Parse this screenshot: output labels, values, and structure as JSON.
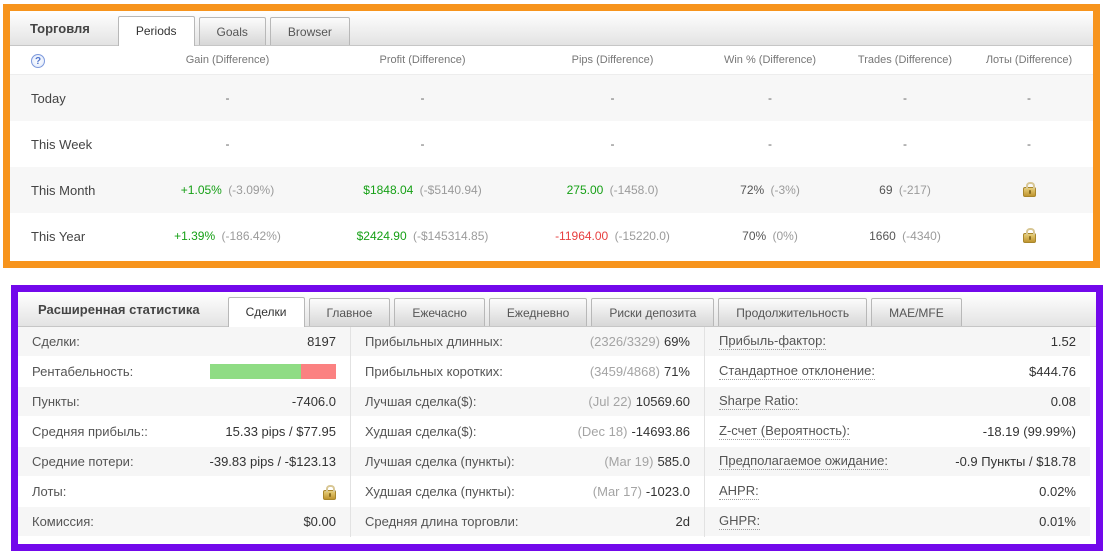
{
  "colors": {
    "annotation_top_border": "#F7941D",
    "annotation_bottom_border": "#7208EB",
    "positive_value": "#16A016",
    "negative_value": "#E74040",
    "muted_value": "#9B9B9B",
    "bar_green": "#8FDC84",
    "bar_red": "#FB8181"
  },
  "icons": {
    "help_glyph": "?"
  },
  "top_panel": {
    "title": "Торговля",
    "tabs": [
      {
        "label": "Periods",
        "active": true
      },
      {
        "label": "Goals",
        "active": false
      },
      {
        "label": "Browser",
        "active": false
      }
    ],
    "columns": [
      "Gain (Difference)",
      "Profit (Difference)",
      "Pips (Difference)",
      "Win % (Difference)",
      "Trades (Difference)",
      "Лоты (Difference)"
    ],
    "rows": [
      {
        "label": "Today",
        "gain": {
          "main": "-"
        },
        "profit": {
          "main": "-"
        },
        "pips": {
          "main": "-"
        },
        "win": {
          "main": "-"
        },
        "trades": {
          "main": "-"
        },
        "lots": {
          "main": "-"
        }
      },
      {
        "label": "This Week",
        "gain": {
          "main": "-"
        },
        "profit": {
          "main": "-"
        },
        "pips": {
          "main": "-"
        },
        "win": {
          "main": "-"
        },
        "trades": {
          "main": "-"
        },
        "lots": {
          "main": "-"
        }
      },
      {
        "label": "This Month",
        "gain": {
          "main": "+1.05%",
          "color": "green",
          "diff": "(-3.09%)"
        },
        "profit": {
          "main": "$1848.04",
          "color": "green",
          "diff": "(-$5140.94)"
        },
        "pips": {
          "main": "275.00",
          "color": "green",
          "diff": "(-1458.0)"
        },
        "win": {
          "main": "72%",
          "color": "dark",
          "diff": "(-3%)"
        },
        "trades": {
          "main": "69",
          "color": "dark",
          "diff": "(-217)"
        },
        "lots": {
          "icon": "lock"
        }
      },
      {
        "label": "This Year",
        "gain": {
          "main": "+1.39%",
          "color": "green",
          "diff": "(-186.42%)"
        },
        "profit": {
          "main": "$2424.90",
          "color": "green",
          "diff": "(-$145314.85)"
        },
        "pips": {
          "main": "-11964.00",
          "color": "red",
          "diff": "(-15220.0)"
        },
        "win": {
          "main": "70%",
          "color": "dark",
          "diff": "(0%)"
        },
        "trades": {
          "main": "1660",
          "color": "dark",
          "diff": "(-4340)"
        },
        "lots": {
          "icon": "lock"
        }
      }
    ]
  },
  "stats_panel": {
    "title": "Расширенная статистика",
    "tabs": [
      {
        "label": "Сделки",
        "active": true
      },
      {
        "label": "Главное",
        "active": false
      },
      {
        "label": "Ежечасно",
        "active": false
      },
      {
        "label": "Ежедневно",
        "active": false
      },
      {
        "label": "Риски депозита",
        "active": false
      },
      {
        "label": "Продолжительность",
        "active": false
      },
      {
        "label": "MAE/MFE",
        "active": false
      }
    ],
    "profitability_bar": {
      "green_width": "72%",
      "red_width": "28%"
    },
    "col1": [
      {
        "label": "Сделки:",
        "value": "8197"
      },
      {
        "label": "Рентабельность:",
        "value_is_bar": true
      },
      {
        "label": "Пункты:",
        "value": "-7406.0"
      },
      {
        "label": "Средняя прибыль::",
        "value": "15.33 pips / $77.95"
      },
      {
        "label": "Средние потери:",
        "value": "-39.83 pips / -$123.13"
      },
      {
        "label": "Лоты:",
        "icon": "lock"
      },
      {
        "label": "Комиссия:",
        "value": "$0.00"
      }
    ],
    "col2": [
      {
        "label": "Прибыльных длинных:",
        "muted": "(2326/3329)",
        "value": "69%"
      },
      {
        "label": "Прибыльных коротких:",
        "muted": "(3459/4868)",
        "value": "71%"
      },
      {
        "label": "Лучшая сделка($):",
        "muted": "(Jul 22)",
        "value": "10569.60"
      },
      {
        "label": "Худшая сделка($):",
        "muted": "(Dec 18)",
        "value": "-14693.86"
      },
      {
        "label": "Лучшая сделка (пункты):",
        "muted": "(Mar 19)",
        "value": "585.0"
      },
      {
        "label": "Худшая сделка (пункты):",
        "muted": "(Mar 17)",
        "value": "-1023.0"
      },
      {
        "label": "Средняя длина торговли:",
        "value": "2d"
      }
    ],
    "col3": [
      {
        "label": "Прибыль-фактор:",
        "value": "1.52"
      },
      {
        "label": "Стандартное отклонение:",
        "value": "$444.76"
      },
      {
        "label": "Sharpe Ratio:",
        "value": "0.08"
      },
      {
        "label": "Z-счет (Вероятность):",
        "value": "-18.19 (99.99%)"
      },
      {
        "label": "Предполагаемое ожидание:",
        "value": "-0.9 Пункты / $18.78"
      },
      {
        "label": "AHPR:",
        "value": "0.02%"
      },
      {
        "label": "GHPR:",
        "value": "0.01%"
      }
    ]
  }
}
